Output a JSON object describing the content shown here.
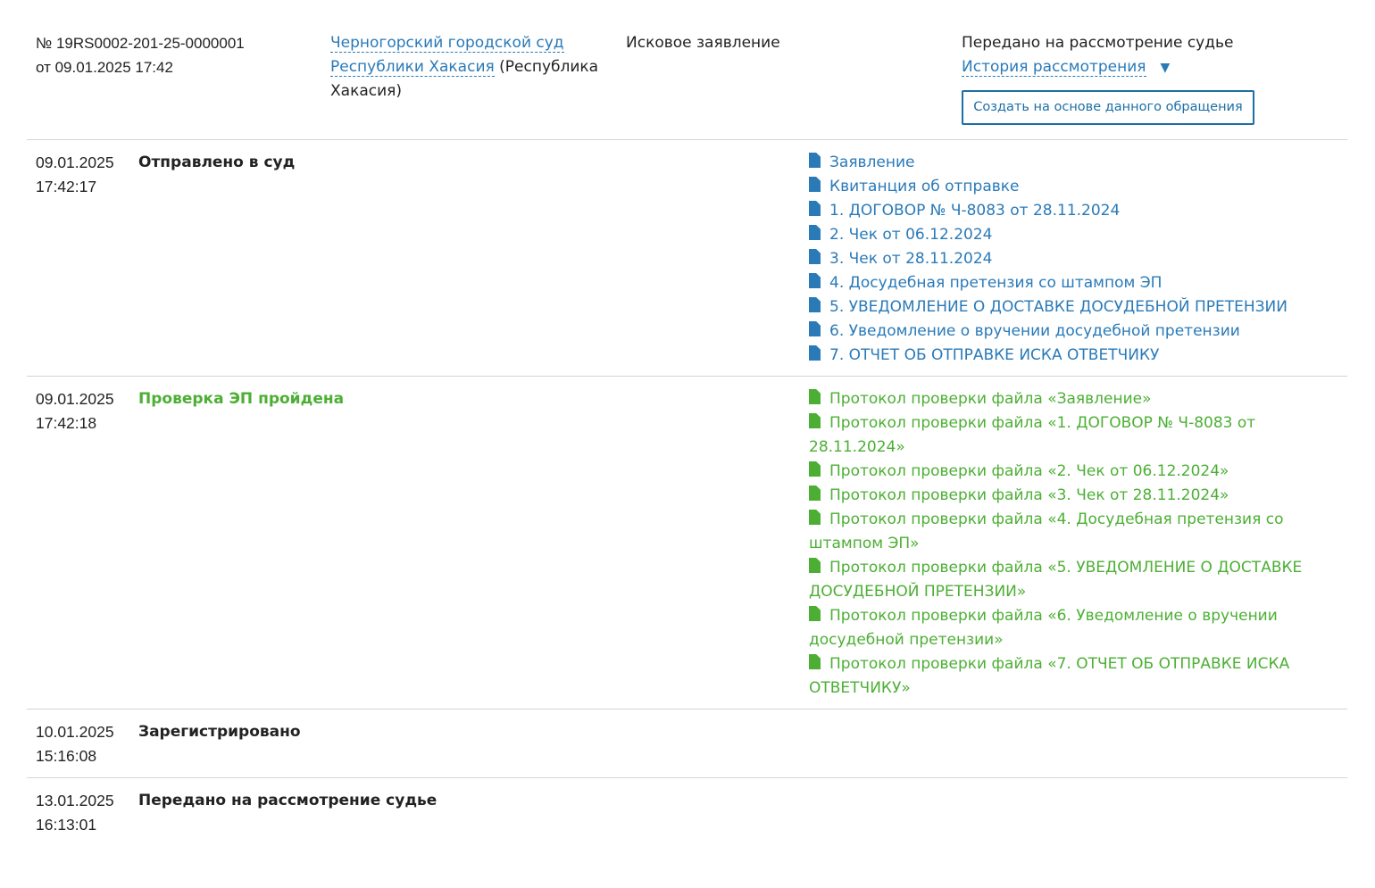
{
  "appeal": {
    "number": "№ 19RS0002-201-25-0000001",
    "date": "от 09.01.2025 17:42",
    "court_link_line1": "Черногорский городской суд",
    "court_link_line2": "Республики Хакасия",
    "court_region": "(Республика Хакасия)",
    "type": "Исковое заявление",
    "status": "Передано на рассмотрение судье",
    "history_link": "История рассмотрения",
    "history_arrow": "▼",
    "create_button": "Создать на основе данного обращения"
  },
  "events": [
    {
      "date": "09.01.2025",
      "time": "17:42:17",
      "title": "Отправлено в суд",
      "files": [
        "Заявление",
        "Квитанция об отправке",
        "1. ДОГОВОР № Ч-8083 от 28.11.2024",
        "2. Чек от 06.12.2024",
        "3. Чек от 28.11.2024",
        "4. Досудебная претензия со штампом ЭП",
        "5. УВЕДОМЛЕНИЕ О ДОСТАВКЕ ДОСУДЕБНОЙ ПРЕТЕНЗИИ",
        "6. Уведомление о вручении досудебной претензии",
        "7. ОТЧЕТ ОБ ОТПРАВКЕ ИСКА ОТВЕТЧИКУ"
      ]
    },
    {
      "date": "09.01.2025",
      "time": "17:42:18",
      "title": "Проверка ЭП пройдена",
      "files": [
        "Протокол проверки файла «Заявление»",
        "Протокол проверки файла «1. ДОГОВОР № Ч-8083 от 28.11.2024»",
        "Протокол проверки файла «2. Чек от 06.12.2024»",
        "Протокол проверки файла «3. Чек от 28.11.2024»",
        "Протокол проверки файла «4. Досудебная претензия со штампом ЭП»",
        "Протокол проверки файла «5. УВЕДОМЛЕНИЕ О ДОСТАВКЕ ДОСУДЕБНОЙ ПРЕТЕНЗИИ»",
        "Протокол проверки файла «6. Уведомление о вручении досудебной претензии»",
        "Протокол проверки файла «7. ОТЧЕТ ОБ ОТПРАВКЕ ИСКА ОТВЕТЧИКУ»"
      ]
    },
    {
      "date": "10.01.2025",
      "time": "15:16:08",
      "title": "Зарегистрировано",
      "files": []
    },
    {
      "date": "13.01.2025",
      "time": "16:13:01",
      "title": "Передано на рассмотрение судье",
      "files": []
    }
  ],
  "colors": {
    "link_blue": "#2a7ab8",
    "success_green": "#4caf34",
    "button_border": "#1d6fa5"
  },
  "icons": {
    "sent_file": "document-icon",
    "protocol_file": "document-check-icon"
  }
}
